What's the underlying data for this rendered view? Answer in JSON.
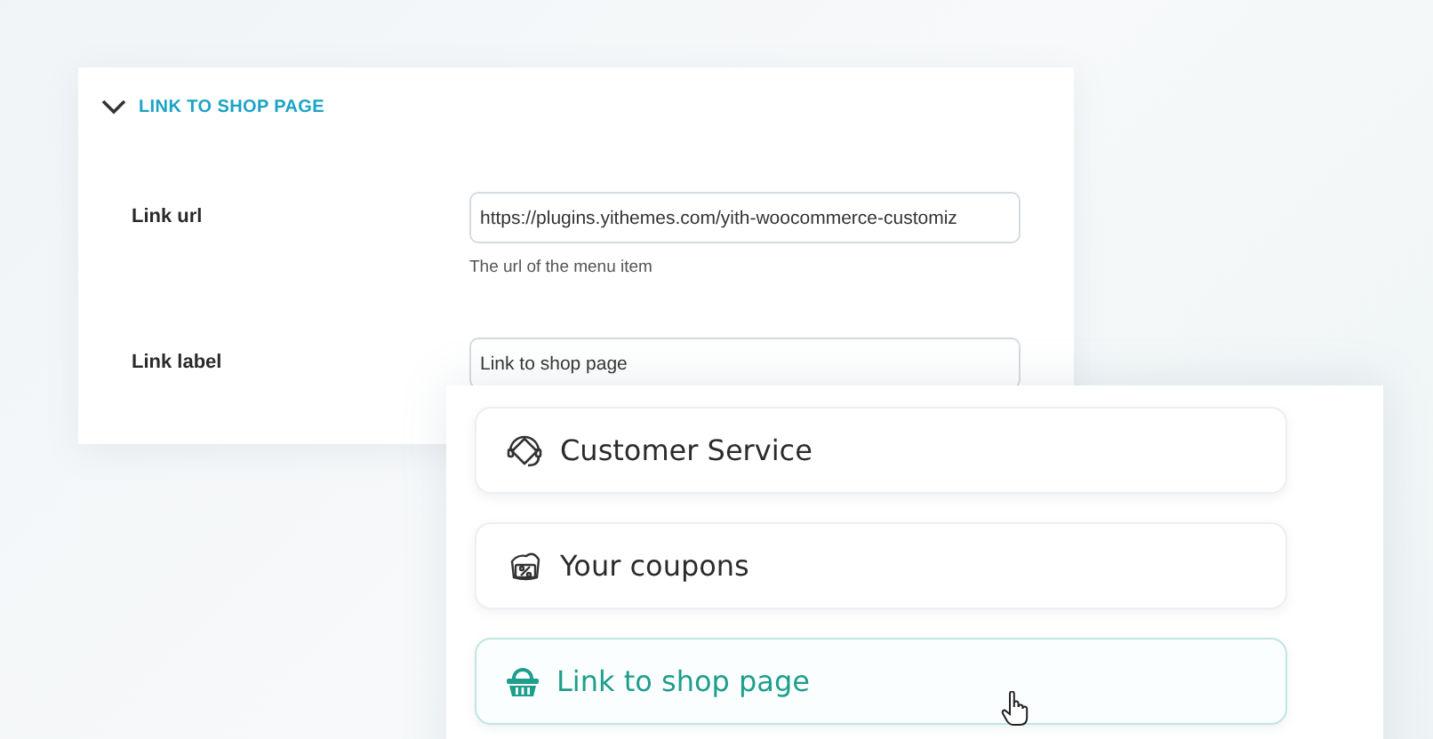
{
  "settings_section": {
    "title": "LINK TO SHOP PAGE",
    "expanded": true,
    "fields": [
      {
        "label": "Link url",
        "value": "https://plugins.yithemes.com/yith-woocommerce-customiz",
        "help": "The url of the menu item"
      },
      {
        "label": "Link label",
        "value": "Link to shop page"
      }
    ]
  },
  "menu_items": [
    {
      "kind": "headset",
      "label": "Customer Service",
      "selected": false
    },
    {
      "kind": "coupon",
      "label": "Your coupons",
      "selected": false
    },
    {
      "kind": "basket",
      "label": "Link to shop page",
      "selected": true
    }
  ]
}
